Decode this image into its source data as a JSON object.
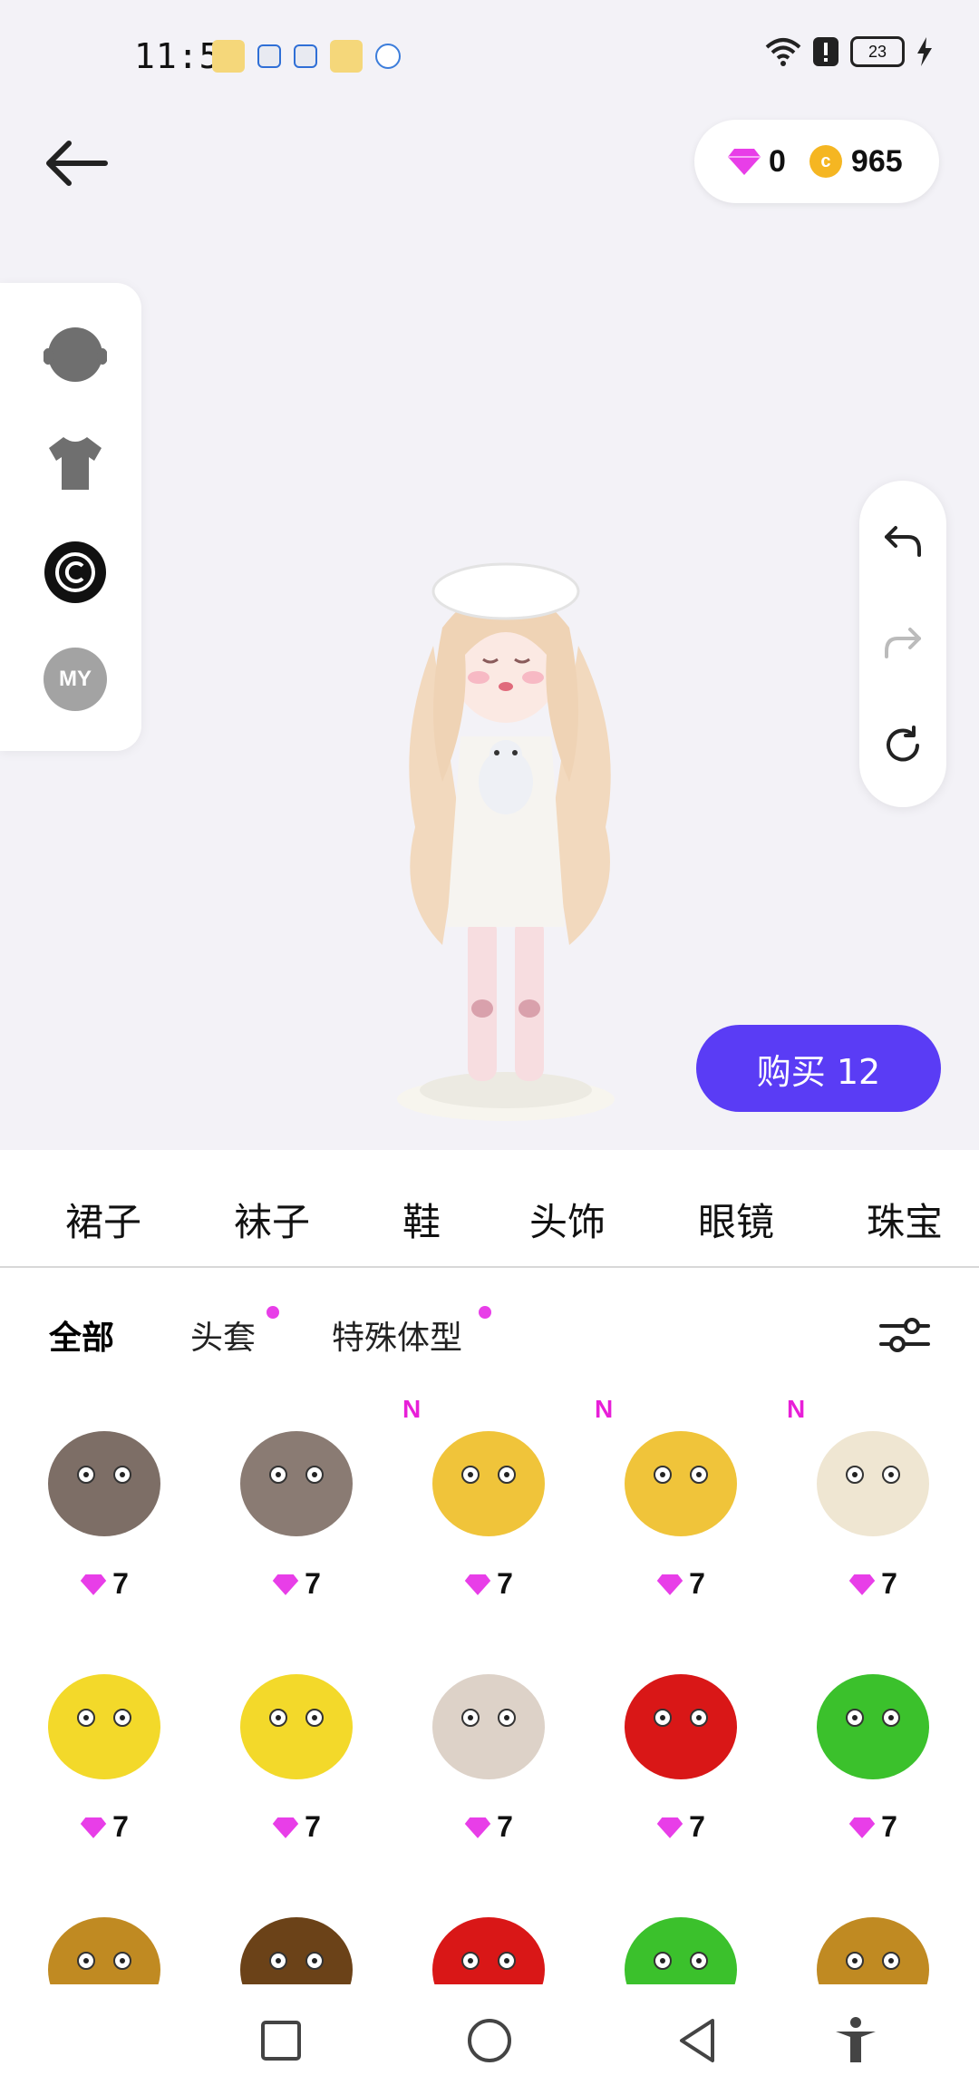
{
  "status_bar": {
    "time": "11:57",
    "battery": "23"
  },
  "currency": {
    "gems": "0",
    "coins": "965"
  },
  "side_categories": [
    {
      "icon": "head-icon"
    },
    {
      "icon": "shirt-icon"
    },
    {
      "icon": "copyright-icon"
    },
    {
      "icon": "my-icon",
      "label": "MY"
    }
  ],
  "history": {
    "undo": "undo-icon",
    "redo": "redo-icon",
    "reset": "reset-icon"
  },
  "buy_button": {
    "label": "购买 12"
  },
  "category_tabs": [
    "裙子",
    "袜子",
    "鞋",
    "头饰",
    "眼镜",
    "珠宝"
  ],
  "sub_tabs": [
    {
      "label": "全部",
      "active": true,
      "dot": false
    },
    {
      "label": "头套",
      "active": false,
      "dot": true
    },
    {
      "label": "特殊体型",
      "active": false,
      "dot": true
    }
  ],
  "items": [
    {
      "name": "hamster-head",
      "price": "7",
      "new": false,
      "color": "#7d6e66"
    },
    {
      "name": "hamster-head-2",
      "price": "7",
      "new": false,
      "color": "#8a7b73"
    },
    {
      "name": "yellow-duck-lying",
      "price": "7",
      "new": true,
      "new_label": "N",
      "color": "#f0c43a"
    },
    {
      "name": "yellow-duck-lying-2",
      "price": "7",
      "new": true,
      "new_label": "N",
      "color": "#f0c43a"
    },
    {
      "name": "double-head",
      "price": "7",
      "new": true,
      "new_label": "N",
      "color": "#efe6d2"
    },
    {
      "name": "yellow-duck",
      "price": "7",
      "new": false,
      "color": "#f3d92a"
    },
    {
      "name": "yellow-duck-2",
      "price": "7",
      "new": false,
      "color": "#f3d92a"
    },
    {
      "name": "capybara",
      "price": "7",
      "new": false,
      "color": "#ddd2c8"
    },
    {
      "name": "red-poop",
      "price": "7",
      "new": false,
      "color": "#d91717"
    },
    {
      "name": "green-poop",
      "price": "7",
      "new": false,
      "color": "#3bc12c"
    },
    {
      "name": "brown-poop",
      "price": "",
      "new": false,
      "color": "#c08a22"
    },
    {
      "name": "dark-poop",
      "price": "",
      "new": false,
      "color": "#6b4218"
    },
    {
      "name": "red-poop-2",
      "price": "",
      "new": false,
      "color": "#d91717"
    },
    {
      "name": "green-poop-2",
      "price": "",
      "new": false,
      "color": "#3bc12c"
    },
    {
      "name": "brown-poop-2",
      "price": "",
      "new": false,
      "color": "#c08a22"
    }
  ],
  "colors": {
    "accent": "#5a3cf5",
    "gem": "#e83ee8",
    "coin": "#f5b622"
  }
}
